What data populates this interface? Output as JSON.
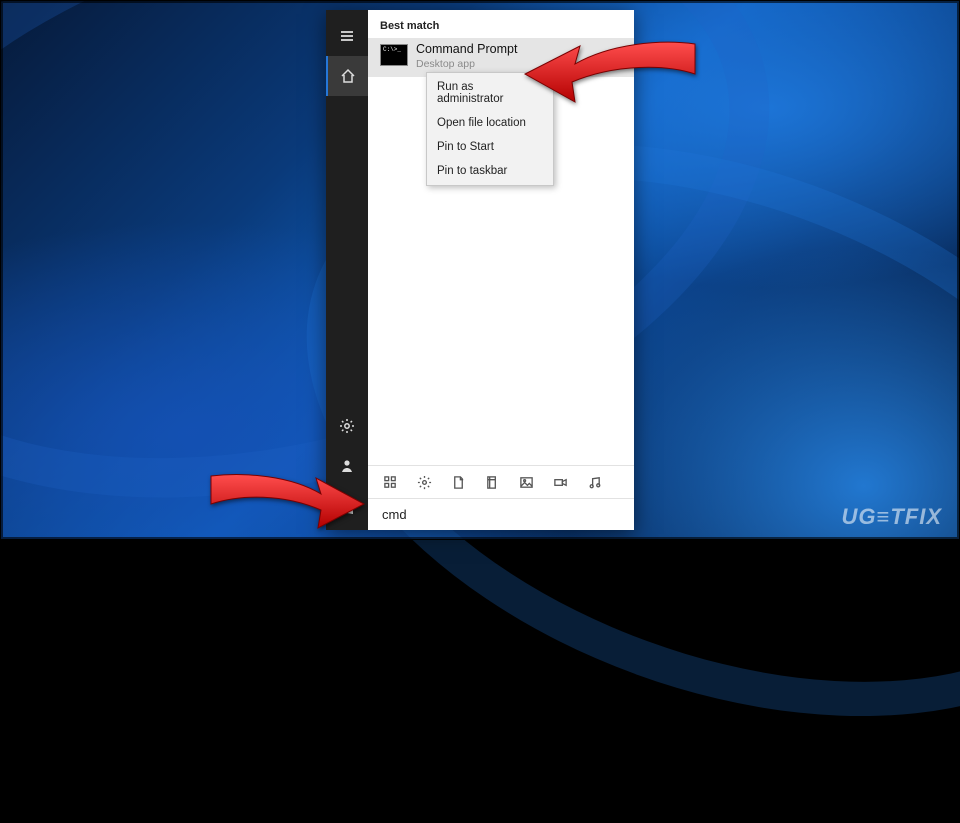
{
  "search": {
    "best_match_label": "Best match",
    "query": "cmd",
    "result": {
      "title": "Command Prompt",
      "subtitle": "Desktop app"
    }
  },
  "context_menu": {
    "items": [
      "Run as administrator",
      "Open file location",
      "Pin to Start",
      "Pin to taskbar"
    ]
  },
  "rail": {
    "icons": [
      "hamburger",
      "home",
      "settings",
      "user",
      "start"
    ]
  },
  "filters": {
    "icons": [
      "apps",
      "settings",
      "documents",
      "web",
      "photos",
      "videos",
      "music"
    ]
  },
  "watermark": "UG≡TFIX"
}
